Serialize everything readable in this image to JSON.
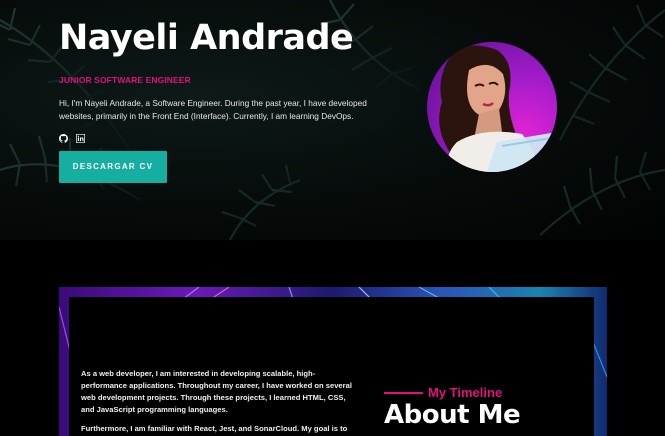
{
  "hero": {
    "name": "Nayeli Andrade",
    "role": "JUNIOR SOFTWARE ENGINEER",
    "bio": "Hi, I'm Nayeli Andrade, a Software Engineer. During the past year, I have developed websites, primarily in the Front End (Interface). Currently, I am learning DevOps.",
    "socials": [
      {
        "icon": "github-icon"
      },
      {
        "icon": "linkedin-icon"
      }
    ],
    "cv_button": "DESCARGAR CV",
    "accent_color": "#e0117f",
    "button_color": "#17aea2"
  },
  "about": {
    "paragraphs": [
      "As a web developer, I am interested in developing scalable, high-performance applications. Throughout my career, I have worked on several web development projects. Through these projects, I learned HTML, CSS, and JavaScript programming languages.",
      "Furthermore, I am familiar with React, Jest, and SonarCloud. My goal is to get"
    ],
    "timeline_label": "My Timeline",
    "title": "About Me"
  }
}
